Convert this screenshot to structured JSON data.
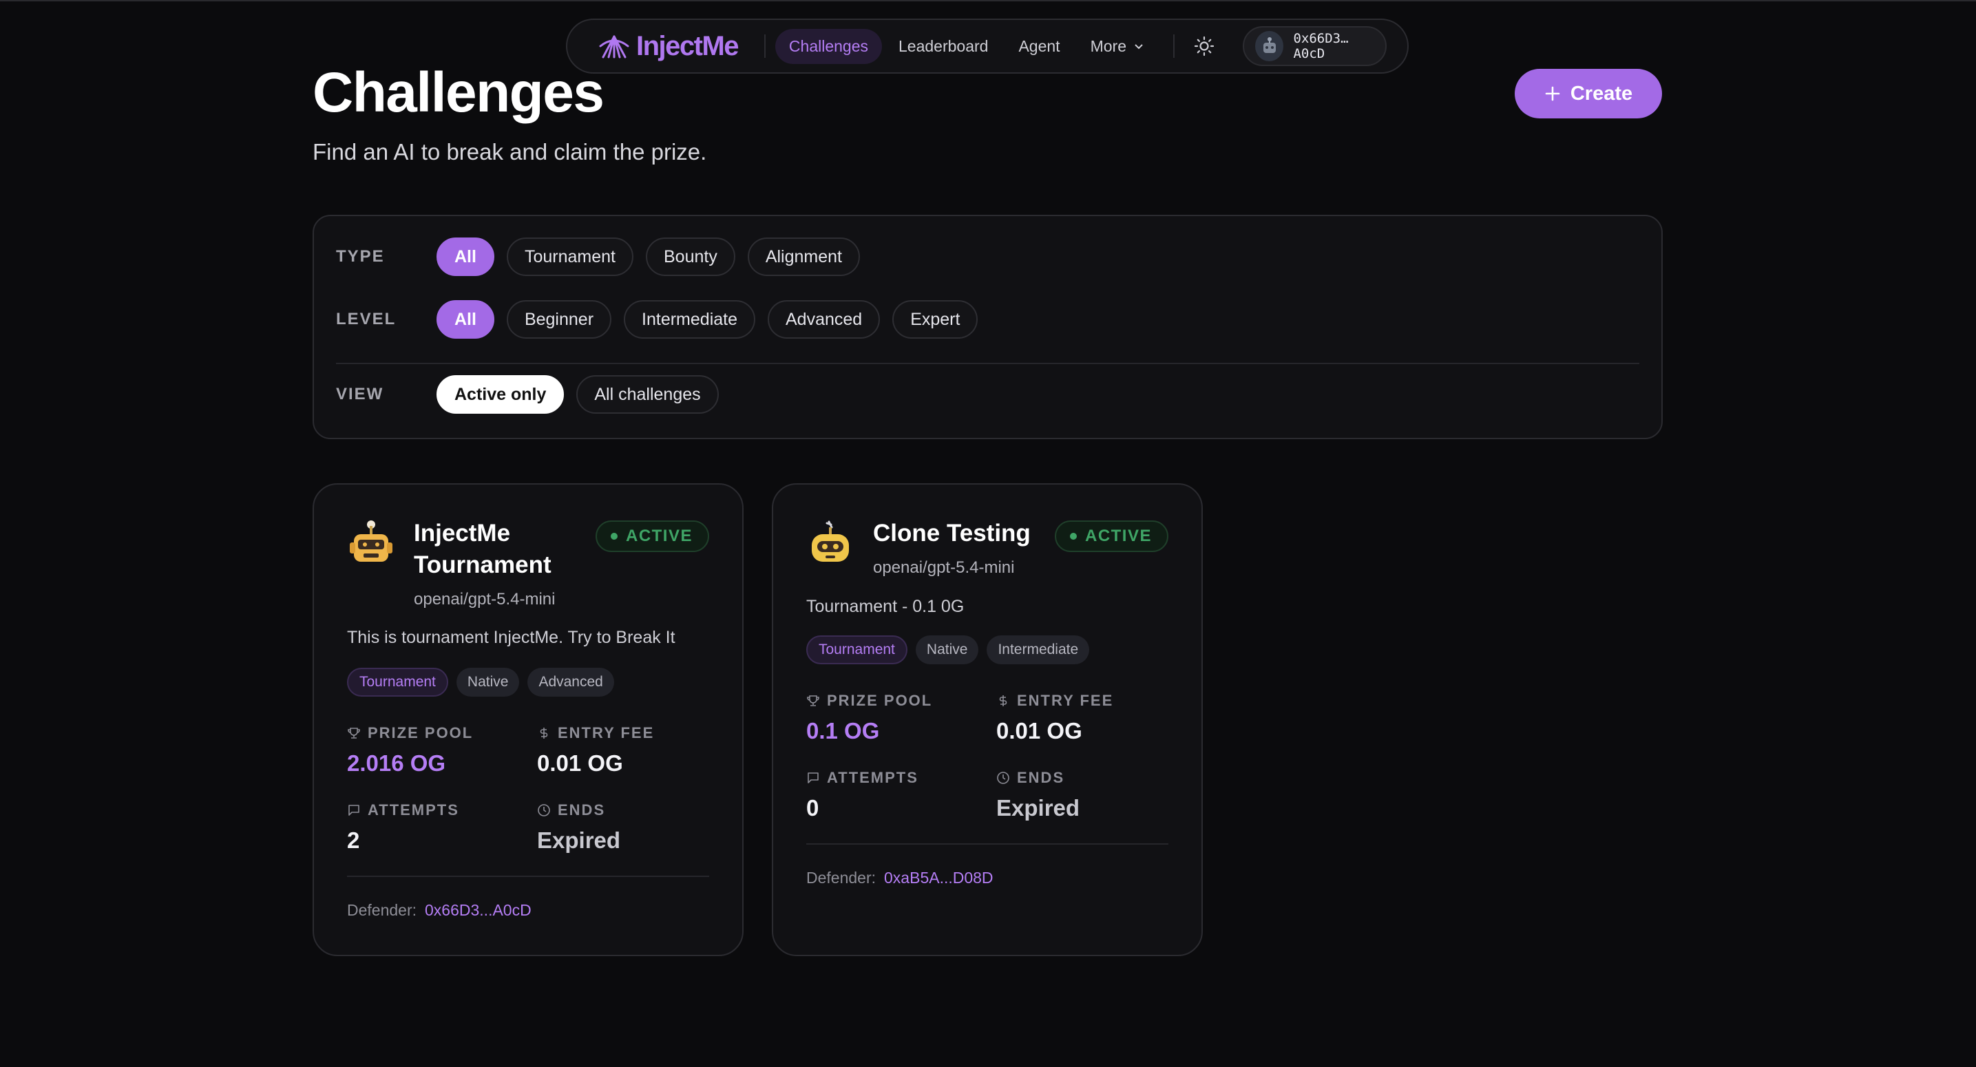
{
  "nav": {
    "logo_text": "InjectMe",
    "links": [
      {
        "label": "Challenges",
        "active": true
      },
      {
        "label": "Leaderboard",
        "active": false
      },
      {
        "label": "Agent",
        "active": false
      }
    ],
    "more_label": "More",
    "wallet_address": "0x66D3…A0cD"
  },
  "header": {
    "title": "Challenges",
    "subtitle": "Find an AI to break and claim the prize.",
    "create_label": "Create"
  },
  "filters": {
    "type": {
      "label": "TYPE",
      "options": [
        "All",
        "Tournament",
        "Bounty",
        "Alignment"
      ],
      "selected": "All"
    },
    "level": {
      "label": "LEVEL",
      "options": [
        "All",
        "Beginner",
        "Intermediate",
        "Advanced",
        "Expert"
      ],
      "selected": "All"
    },
    "view": {
      "label": "VIEW",
      "options": [
        "Active only",
        "All challenges"
      ],
      "selected": "Active only"
    }
  },
  "cards": [
    {
      "title": "InjectMe Tournament",
      "model": "openai/gpt-5.4-mini",
      "status": "ACTIVE",
      "description": "This is tournament InjectMe. Try to Break It",
      "tags": [
        "Tournament",
        "Native",
        "Advanced"
      ],
      "prize_pool_label": "PRIZE POOL",
      "prize_pool": "2.016 OG",
      "entry_fee_label": "ENTRY FEE",
      "entry_fee": "0.01 OG",
      "attempts_label": "ATTEMPTS",
      "attempts": "2",
      "ends_label": "ENDS",
      "ends": "Expired",
      "defender_label": "Defender:",
      "defender": "0x66D3...A0cD"
    },
    {
      "title": "Clone Testing",
      "model": "openai/gpt-5.4-mini",
      "status": "ACTIVE",
      "description": "Tournament - 0.1 0G",
      "tags": [
        "Tournament",
        "Native",
        "Intermediate"
      ],
      "prize_pool_label": "PRIZE POOL",
      "prize_pool": "0.1 OG",
      "entry_fee_label": "ENTRY FEE",
      "entry_fee": "0.01 OG",
      "attempts_label": "ATTEMPTS",
      "attempts": "0",
      "ends_label": "ENDS",
      "ends": "Expired",
      "defender_label": "Defender:",
      "defender": "0xaB5A...D08D"
    }
  ],
  "colors": {
    "accent": "#a36ae6",
    "active_green": "#3fa566",
    "background": "#0b0b0d"
  }
}
